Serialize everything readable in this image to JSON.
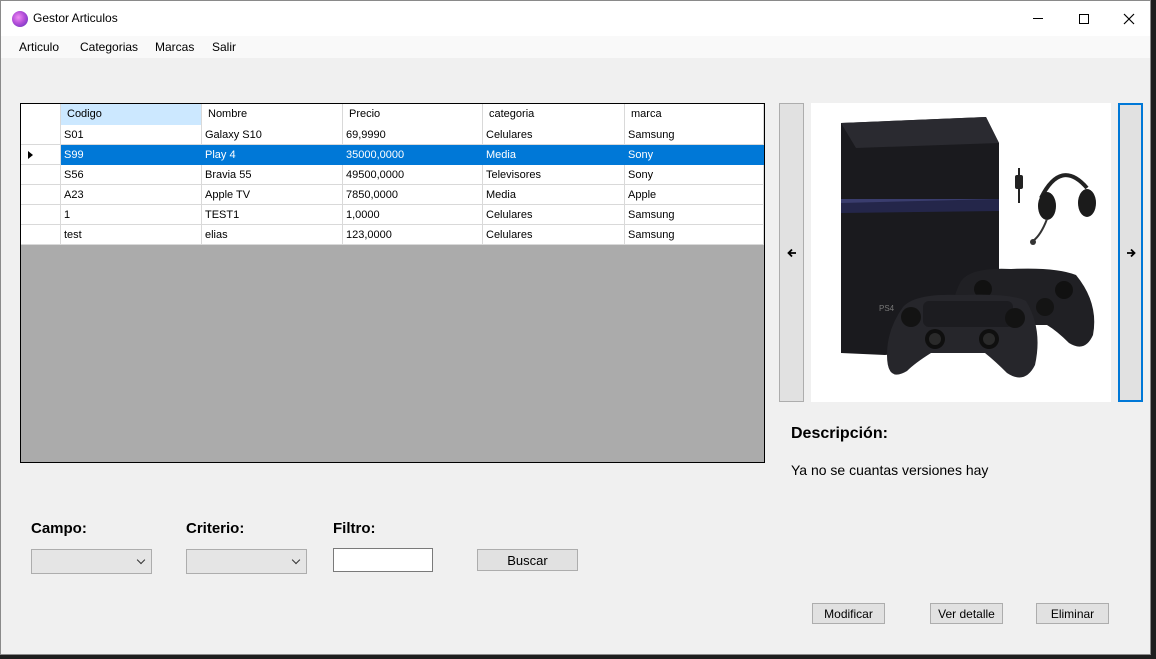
{
  "window": {
    "title": "Gestor Articulos"
  },
  "menu": {
    "items": [
      "Articulo",
      "Categorias",
      "Marcas",
      "Salir"
    ]
  },
  "grid": {
    "columns": [
      "Codigo",
      "Nombre",
      "Precio",
      "categoria",
      "marca"
    ],
    "selected_row": 1,
    "rows": [
      [
        "S01",
        "Galaxy S10",
        "69,9990",
        "Celulares",
        "Samsung"
      ],
      [
        "S99",
        "Play 4",
        "35000,0000",
        "Media",
        "Sony"
      ],
      [
        "S56",
        "Bravia 55",
        "49500,0000",
        "Televisores",
        "Sony"
      ],
      [
        "A23",
        "Apple TV",
        "7850,0000",
        "Media",
        "Apple"
      ],
      [
        "1",
        "TEST1",
        "1,0000",
        "Celulares",
        "Samsung"
      ],
      [
        "test",
        "elias",
        "123,0000",
        "Celulares",
        "Samsung"
      ]
    ]
  },
  "image_nav": {
    "prev_label": "🡐",
    "next_label": "🡒"
  },
  "detail": {
    "desc_label": "Descripción:",
    "desc_text": "Ya no se cuantas versiones hay"
  },
  "filter": {
    "campo_label": "Campo:",
    "criterio_label": "Criterio:",
    "filtro_label": "Filtro:",
    "search_button": "Buscar"
  },
  "actions": {
    "modify": "Modificar",
    "view_detail": "Ver detalle",
    "delete": "Eliminar"
  }
}
